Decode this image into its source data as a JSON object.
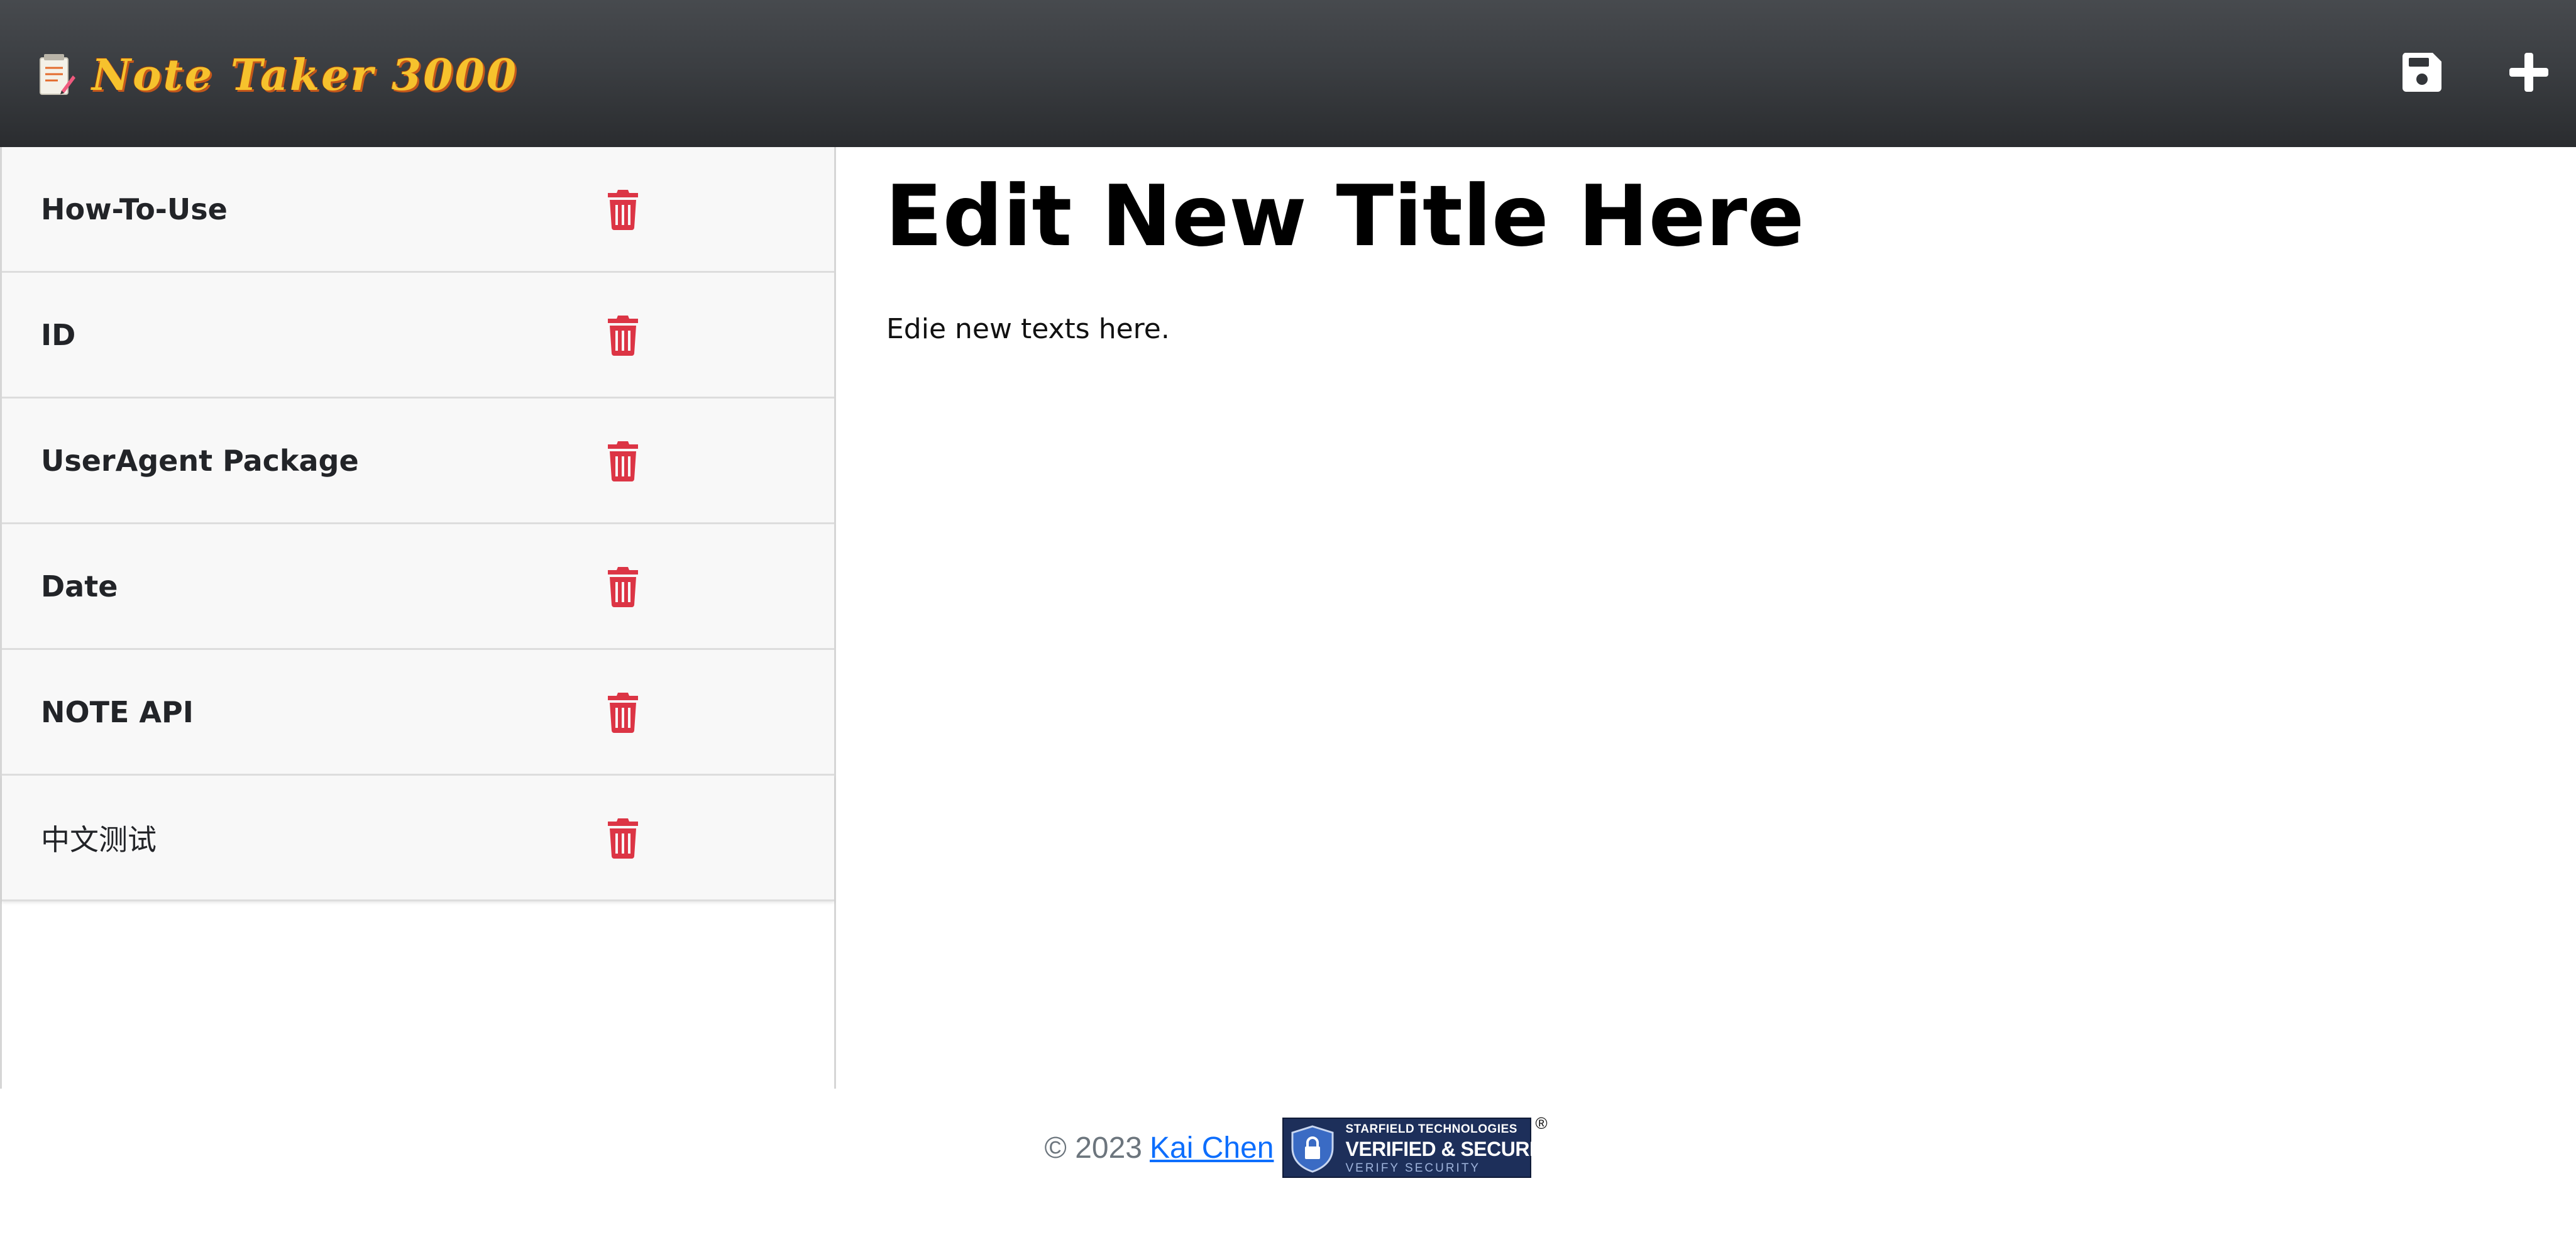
{
  "header": {
    "app_name": "Note Taker 3000",
    "brand_icon": "memo-pencil-icon",
    "actions": [
      {
        "name": "save-note-button",
        "icon": "floppy-disk-icon"
      },
      {
        "name": "new-note-button",
        "icon": "plus-icon"
      }
    ]
  },
  "sidebar": {
    "notes": [
      {
        "title": "How-To-Use"
      },
      {
        "title": "ID"
      },
      {
        "title": "UserAgent Package"
      },
      {
        "title": "Date"
      },
      {
        "title": "NOTE API"
      },
      {
        "title": "中文测试"
      }
    ],
    "delete_icon": "trash-icon",
    "delete_color": "#dc3545"
  },
  "editor": {
    "title": "Edit New Title Here",
    "text": "Edie new texts here."
  },
  "footer": {
    "copyright": "© 2023",
    "author": "Kai Chen",
    "seal": {
      "line1": "STARFIELD TECHNOLOGIES",
      "line2": "VERIFIED & SECURED",
      "line3": "VERIFY SECURITY",
      "registered": "®"
    }
  },
  "colors": {
    "header_bg": "#3b3e42",
    "brand_text": "#f6c22d",
    "link": "#0d6efd",
    "footer_text": "#6c757d"
  }
}
